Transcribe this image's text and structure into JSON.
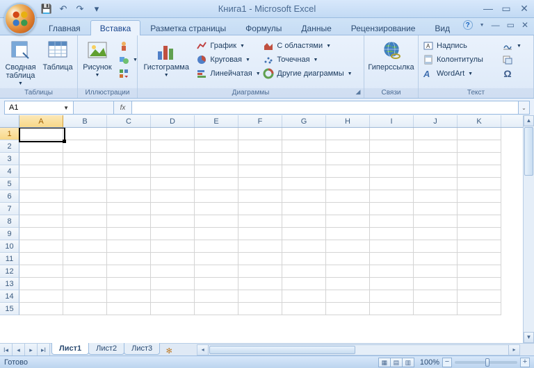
{
  "title": "Книга1 - Microsoft Excel",
  "qat": {
    "save": "💾",
    "undo": "↶",
    "redo": "↷",
    "more": "▾"
  },
  "tabs": [
    {
      "label": "Главная"
    },
    {
      "label": "Вставка"
    },
    {
      "label": "Разметка страницы"
    },
    {
      "label": "Формулы"
    },
    {
      "label": "Данные"
    },
    {
      "label": "Рецензирование"
    },
    {
      "label": "Вид"
    }
  ],
  "active_tab": 1,
  "ribbon": {
    "tables": {
      "label": "Таблицы",
      "pivot": "Сводная таблица",
      "table": "Таблица"
    },
    "illustr": {
      "label": "Иллюстрации",
      "picture": "Рисунок"
    },
    "charts": {
      "label": "Диаграммы",
      "histogram": "Гистограмма",
      "line": "График",
      "pie": "Круговая",
      "bar": "Линейчатая",
      "area": "С областями",
      "scatter": "Точечная",
      "other": "Другие диаграммы"
    },
    "links": {
      "label": "Связи",
      "hyperlink": "Гиперссылка"
    },
    "text": {
      "label": "Текст",
      "textbox": "Надпись",
      "headerfooter": "Колонтитулы",
      "wordart": "WordArt"
    }
  },
  "namebox": "A1",
  "fx": "fx",
  "formula": "",
  "columns": [
    "A",
    "B",
    "C",
    "D",
    "E",
    "F",
    "G",
    "H",
    "I",
    "J",
    "K"
  ],
  "rows": [
    1,
    2,
    3,
    4,
    5,
    6,
    7,
    8,
    9,
    10,
    11,
    12,
    13,
    14,
    15
  ],
  "selected": {
    "col": "A",
    "row": 1
  },
  "sheets": [
    {
      "label": "Лист1",
      "active": true
    },
    {
      "label": "Лист2",
      "active": false
    },
    {
      "label": "Лист3",
      "active": false
    }
  ],
  "status": {
    "ready": "Готово",
    "zoom": "100%"
  }
}
